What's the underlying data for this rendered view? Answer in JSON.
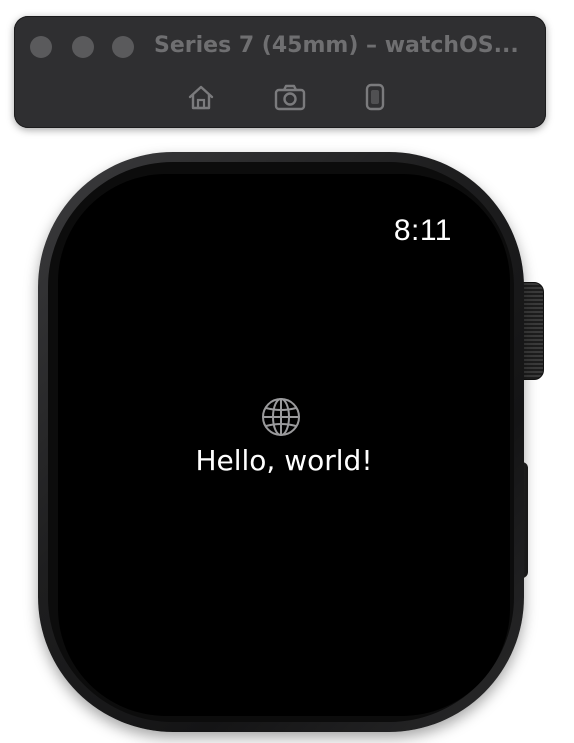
{
  "simulator": {
    "title": "Series 7 (45mm) – watchOS...",
    "toolbar": {
      "home_icon": "home-icon",
      "screenshot_icon": "camera-icon",
      "rotate_icon": "device-icon"
    }
  },
  "watch": {
    "time": "8:11",
    "content": {
      "icon": "globe-icon",
      "text": "Hello, world!"
    }
  },
  "colors": {
    "titlebar": "#2f2f31",
    "title_text": "#6f6f71",
    "screen": "#000000",
    "text": "#ffffff",
    "icon_gray": "#9a9a9c"
  }
}
